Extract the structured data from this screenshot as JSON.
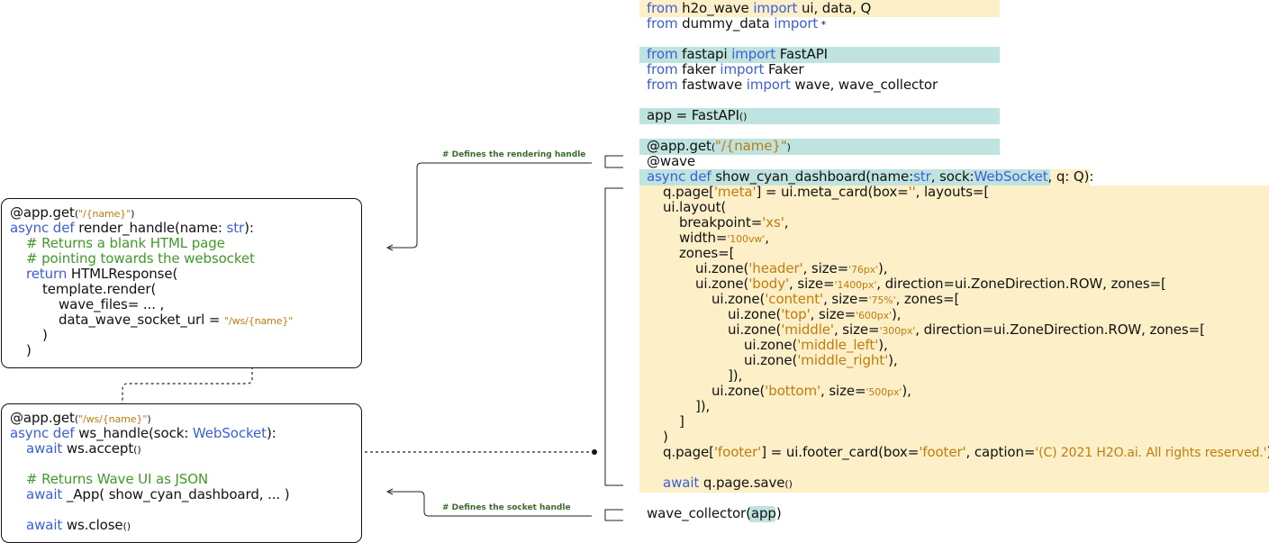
{
  "colors": {
    "keyword": "#3b5fd6",
    "string": "#c17b0c",
    "comment": "#3f9a2a",
    "highlight_yellow": "#fdf0c9",
    "highlight_teal": "#bfe3df"
  },
  "code": {
    "l1": {
      "a": "from",
      "b": " h2o_wave ",
      "c": "import",
      "d": " ui, data, Q"
    },
    "l2": {
      "a": "from",
      "b": " dummy_data ",
      "c": "import",
      "d": " *"
    },
    "l3": {
      "a": "from",
      "b": " fastapi ",
      "c": "import",
      "d": " FastAPI"
    },
    "l4": {
      "a": "from",
      "b": " faker ",
      "c": "import",
      "d": " Faker"
    },
    "l5": {
      "a": "from",
      "b": " fastwave ",
      "c": "import",
      "d": " wave, wave_collector"
    },
    "l6": {
      "a": "app = FastAPI",
      "b": "()"
    },
    "l7": {
      "a": "@app.get",
      "b": "(",
      "c": "\"/{name}\"",
      "d": ")"
    },
    "l8": {
      "a": "@wave"
    },
    "l9": {
      "a": "async def",
      "b": " show_cyan_dashboard(name:",
      "c": "str",
      "d": ", sock:",
      "e": "WebSocket",
      "f": ", q: Q):"
    },
    "l10": {
      "a": "q.page[",
      "b": "'meta'",
      "c": "] = ui.meta_card(box=",
      "d": "''",
      "e": ", layouts=["
    },
    "l11": {
      "a": "ui.layout("
    },
    "l12": {
      "a": "breakpoint=",
      "b": "'xs'",
      "c": ","
    },
    "l13": {
      "a": "width=",
      "b": "'100vw'",
      "c": ","
    },
    "l14": {
      "a": "zones=["
    },
    "l15": {
      "a": "ui.zone(",
      "b": "'header'",
      "c": ", size=",
      "d": "'76px'",
      "e": "),"
    },
    "l16": {
      "a": "ui.zone(",
      "b": "'body'",
      "c": ", size=",
      "d": "'1400px'",
      "e": ", direction=ui.ZoneDirection.ROW, zones=["
    },
    "l17": {
      "a": "ui.zone(",
      "b": "'content'",
      "c": ", size=",
      "d": "'75%'",
      "e": ", zones=["
    },
    "l18": {
      "a": "ui.zone(",
      "b": "'top'",
      "c": ", size=",
      "d": "'600px'",
      "e": "),"
    },
    "l19": {
      "a": "ui.zone(",
      "b": "'middle'",
      "c": ", size=",
      "d": "'300px'",
      "e": ", direction=ui.ZoneDirection.ROW, zones=["
    },
    "l20": {
      "a": "ui.zone(",
      "b": "'middle_left'",
      "c": "),"
    },
    "l21": {
      "a": "ui.zone(",
      "b": "'middle_right'",
      "c": "),"
    },
    "l22": {
      "a": "]),"
    },
    "l23": {
      "a": "ui.zone(",
      "b": "'bottom'",
      "c": ", size=",
      "d": "'500px'",
      "e": "),"
    },
    "l24": {
      "a": "]),"
    },
    "l25": {
      "a": "]"
    },
    "l26": {
      "a": ")"
    },
    "l27": {
      "a": "q.page[",
      "b": "'footer'",
      "c": "] = ui.footer_card(box=",
      "d": "'footer'",
      "e": ", caption=",
      "f": "'(C) 2021 H2O.ai. All rights reserved.'",
      "g": ")"
    },
    "l28": {
      "a": "await",
      "b": " q.page.save",
      "c": "()"
    },
    "l29": {
      "a": "wave_collector(",
      "b": "app",
      "c": ")"
    }
  },
  "render_box": {
    "l1": {
      "a": "@app.get",
      "b": "(",
      "c": "\"/{name}\"",
      "d": ")"
    },
    "l2": {
      "a": "async def",
      "b": " render_handle(name: ",
      "c": "str",
      "d": "):"
    },
    "l3": {
      "a": "# Returns a blank HTML page"
    },
    "l4": {
      "a": "# pointing towards the websocket"
    },
    "l5": {
      "a": "return",
      "b": " HTMLResponse("
    },
    "l6": {
      "a": "template.render("
    },
    "l7": {
      "a": "wave_files= ... ,"
    },
    "l8": {
      "a": "data_wave_socket_url = ",
      "b": "\"/ws/{name}\""
    },
    "l9": {
      "a": ")"
    },
    "l10": {
      "a": ")"
    }
  },
  "ws_box": {
    "l1": {
      "a": "@app.get",
      "b": "(",
      "c": "\"/ws/{name}\"",
      "d": ")"
    },
    "l2": {
      "a": "async def",
      "b": " ws_handle(sock: ",
      "c": "WebSocket",
      "d": "):"
    },
    "l3": {
      "a": "await",
      "b": " ws.accept",
      "c": "()"
    },
    "l4": {
      "a": "# Returns Wave UI as JSON"
    },
    "l5": {
      "a": "await",
      "b": " _App( show_cyan_dashboard, ... )"
    },
    "l6": {
      "a": "await",
      "b": " ws.close",
      "c": "()"
    }
  },
  "labels": {
    "rendering": "# Defines the rendering handle",
    "socket": "# Defines the socket handle"
  }
}
